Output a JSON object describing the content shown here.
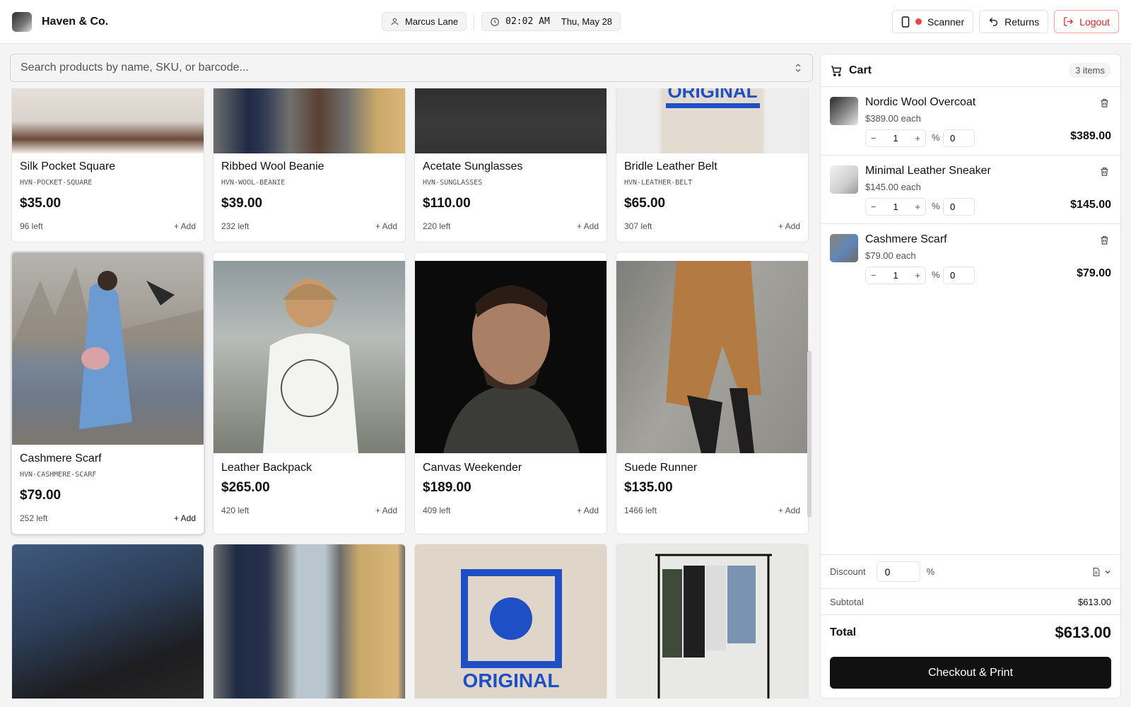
{
  "header": {
    "store_name": "Haven & Co.",
    "cashier": "Marcus Lane",
    "time": "02:02 AM",
    "date": "Thu, May 28",
    "buttons": {
      "scanner": "Scanner",
      "returns": "Returns",
      "logout": "Logout"
    }
  },
  "search": {
    "placeholder": "Search products by name, SKU, or barcode..."
  },
  "products": [
    {
      "name": "Silk Pocket Square",
      "sku": "HVN-POCKET-SQUARE",
      "price": "$35.00",
      "stock": "96 left",
      "add": "+ Add"
    },
    {
      "name": "Ribbed Wool Beanie",
      "sku": "HVN-WOOL-BEANIE",
      "price": "$39.00",
      "stock": "232 left",
      "add": "+ Add"
    },
    {
      "name": "Acetate Sunglasses",
      "sku": "HVN-SUNGLASSES",
      "price": "$110.00",
      "stock": "220 left",
      "add": "+ Add"
    },
    {
      "name": "Bridle Leather Belt",
      "sku": "HVN-LEATHER-BELT",
      "price": "$65.00",
      "stock": "307 left",
      "add": "+ Add"
    },
    {
      "name": "Cashmere Scarf",
      "sku": "HVN-CASHMERE-SCARF",
      "price": "$79.00",
      "stock": "252 left",
      "add": "+ Add"
    },
    {
      "name": "Leather Backpack",
      "price": "$265.00",
      "stock": "420 left",
      "add": "+ Add"
    },
    {
      "name": "Canvas Weekender",
      "price": "$189.00",
      "stock": "409 left",
      "add": "+ Add"
    },
    {
      "name": "Suede Runner",
      "price": "$135.00",
      "stock": "1466 left",
      "add": "+ Add"
    }
  ],
  "cart": {
    "title": "Cart",
    "count": "3 items",
    "items": [
      {
        "name": "Nordic Wool Overcoat",
        "each": "$389.00 each",
        "qty": "1",
        "discount": "0",
        "total": "$389.00"
      },
      {
        "name": "Minimal Leather Sneaker",
        "each": "$145.00 each",
        "qty": "1",
        "discount": "0",
        "total": "$145.00"
      },
      {
        "name": "Cashmere Scarf",
        "each": "$79.00 each",
        "qty": "1",
        "discount": "0",
        "total": "$79.00"
      }
    ],
    "percent_sign": "%",
    "discount_label": "Discount",
    "discount_value": "0",
    "subtotal_label": "Subtotal",
    "subtotal": "$613.00",
    "total_label": "Total",
    "total": "$613.00",
    "checkout": "Checkout & Print"
  },
  "colors": {
    "danger": "#dc2626",
    "primary": "#111111",
    "muted": "#52525b"
  }
}
